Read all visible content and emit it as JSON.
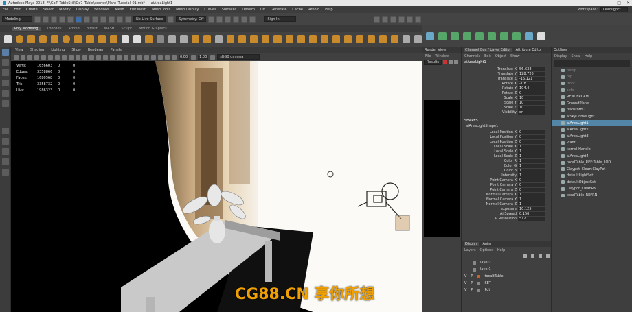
{
  "window": {
    "title": "Autodesk Maya 2018: F:\\Go7_TableStill\\Go7_Table\\scenes\\Plant_Tutorial_01.mb* --- aiAreaLight1",
    "controls": [
      "—",
      "□",
      "✕"
    ]
  },
  "menubar": {
    "items": [
      "File",
      "Edit",
      "Create",
      "Select",
      "Modify",
      "Display",
      "Windows",
      "Mesh",
      "Edit Mesh",
      "Mesh Tools",
      "Mesh Display",
      "Curves",
      "Surfaces",
      "Deform",
      "UV",
      "Generate",
      "Cache",
      "Arnold",
      "Help"
    ],
    "workspace_label": "Workspace:",
    "workspace_value": "Leadlight*"
  },
  "statusline": {
    "mode": "Modeling",
    "no_live": "No Live Surface",
    "symmetry": "Symmetry: Off",
    "sign_in": "Sign In"
  },
  "shelf": {
    "tabs": [
      "Poly Modeling",
      "Lookdev",
      "Arnold",
      "Bifrost",
      "MASH",
      "Sculpt",
      "Motion Graphics"
    ],
    "active": "Poly Modeling"
  },
  "viewport": {
    "menu": [
      "View",
      "Shading",
      "Lighting",
      "Show",
      "Renderer",
      "Panels"
    ],
    "near": "0.00",
    "far": "1.00",
    "color_space": "sRGB gamma",
    "hud": [
      {
        "k": "Verts:",
        "v": "1656603",
        "a": "0",
        "b": "0"
      },
      {
        "k": "Edges:",
        "v": "3358866",
        "a": "0",
        "b": "0"
      },
      {
        "k": "Faces:",
        "v": "1680568",
        "a": "0",
        "b": "0"
      },
      {
        "k": "Tris:",
        "v": "3358732",
        "a": "0",
        "b": "0"
      },
      {
        "k": "UVs:",
        "v": "1986323",
        "a": "0",
        "b": "0"
      }
    ]
  },
  "renderview": {
    "title": "Render View",
    "menu": [
      "File",
      "Window"
    ],
    "tab": "Results"
  },
  "channelbox": {
    "tabs": [
      "Channel Box / Layer Editor",
      "Attribute Editor"
    ],
    "menu": [
      "Channels",
      "Edit",
      "Object",
      "Show"
    ],
    "node": "aiAreaLight1",
    "transform": [
      {
        "k": "Translate X",
        "v": "56.638"
      },
      {
        "k": "Translate Y",
        "v": "128.720"
      },
      {
        "k": "Translate Z",
        "v": "-15.121"
      },
      {
        "k": "Rotate X",
        "v": "-1.8"
      },
      {
        "k": "Rotate Y",
        "v": "104.4"
      },
      {
        "k": "Rotate Z",
        "v": "0"
      },
      {
        "k": "Scale X",
        "v": "10"
      },
      {
        "k": "Scale Y",
        "v": "10"
      },
      {
        "k": "Scale Z",
        "v": "10"
      },
      {
        "k": "Visibility",
        "v": "on"
      }
    ],
    "shapes_label": "SHAPES",
    "shape_node": "aiAreaLightShape1",
    "shape": [
      {
        "k": "Local Position X",
        "v": "0"
      },
      {
        "k": "Local Position Y",
        "v": "0"
      },
      {
        "k": "Local Position Z",
        "v": "0"
      },
      {
        "k": "Local Scale X",
        "v": "1"
      },
      {
        "k": "Local Scale Y",
        "v": "1"
      },
      {
        "k": "Local Scale Z",
        "v": "1"
      },
      {
        "k": "Color R",
        "v": "1"
      },
      {
        "k": "Color G",
        "v": "1"
      },
      {
        "k": "Color B",
        "v": "1"
      },
      {
        "k": "Intensity",
        "v": "1"
      },
      {
        "k": "Point Camera X",
        "v": "0"
      },
      {
        "k": "Point Camera Y",
        "v": "0"
      },
      {
        "k": "Point Camera Z",
        "v": "0"
      },
      {
        "k": "Normal Camera X",
        "v": "1"
      },
      {
        "k": "Normal Camera Y",
        "v": "1"
      },
      {
        "k": "Normal Camera Z",
        "v": "1"
      },
      {
        "k": "exposure",
        "v": "10.125"
      },
      {
        "k": "Ai Spread",
        "v": "0.156"
      },
      {
        "k": "Ai Resolution",
        "v": "512"
      }
    ],
    "layer_tabs": [
      "Display",
      "Anim"
    ],
    "layer_menu": [
      "Layers",
      "Options",
      "Help"
    ],
    "layers": [
      {
        "v": "",
        "p": "",
        "name": "layer2",
        "color": "#888888"
      },
      {
        "v": "",
        "p": "",
        "name": "layer1",
        "color": "#888888"
      },
      {
        "v": "V",
        "p": "P",
        "name": "tocaltTable",
        "color": "#c8622a"
      },
      {
        "v": "V",
        "p": "P",
        "name": "SET",
        "color": "#888888"
      },
      {
        "v": "V",
        "p": "P",
        "name": "Pot",
        "color": "#888888"
      }
    ]
  },
  "outliner": {
    "title": "Outliner",
    "menu": [
      "Display",
      "Show",
      "Help"
    ],
    "items": [
      {
        "name": "persp",
        "sel": false,
        "dim": true
      },
      {
        "name": "top",
        "sel": false,
        "dim": true
      },
      {
        "name": "front",
        "sel": false,
        "dim": true
      },
      {
        "name": "side",
        "sel": false,
        "dim": true
      },
      {
        "name": "RENDERCAM",
        "sel": false,
        "dim": false
      },
      {
        "name": "GroundPlane",
        "sel": false,
        "dim": false
      },
      {
        "name": "transform1",
        "sel": false,
        "dim": false
      },
      {
        "name": "aiSkyDomeLight1",
        "sel": false,
        "dim": false
      },
      {
        "name": "aiAreaLight1",
        "sel": true,
        "dim": false
      },
      {
        "name": "aiAreaLight2",
        "sel": false,
        "dim": false
      },
      {
        "name": "aiAreaLight3",
        "sel": false,
        "dim": false
      },
      {
        "name": "Plant",
        "sel": false,
        "dim": false
      },
      {
        "name": "kernel:Handle",
        "sel": false,
        "dim": false
      },
      {
        "name": "aiAreaLight4",
        "sel": false,
        "dim": false
      },
      {
        "name": "tocalTable_REF:Table_LOD",
        "sel": false,
        "dim": false
      },
      {
        "name": "Claypot_Clean:ClayPot",
        "sel": false,
        "dim": false
      },
      {
        "name": "defaultLightSet",
        "sel": false,
        "dim": false
      },
      {
        "name": "defaultObjectSet",
        "sel": false,
        "dim": false
      },
      {
        "name": "Claypot_CleanRN",
        "sel": false,
        "dim": false
      },
      {
        "name": "tocalTable_REFRN",
        "sel": false,
        "dim": false
      }
    ]
  },
  "watermark": "CG88.CN 享你所想",
  "colors": {
    "accent": "#5285a6",
    "shelf_orange": "#c88a2a",
    "watermark": "#f0a000"
  }
}
